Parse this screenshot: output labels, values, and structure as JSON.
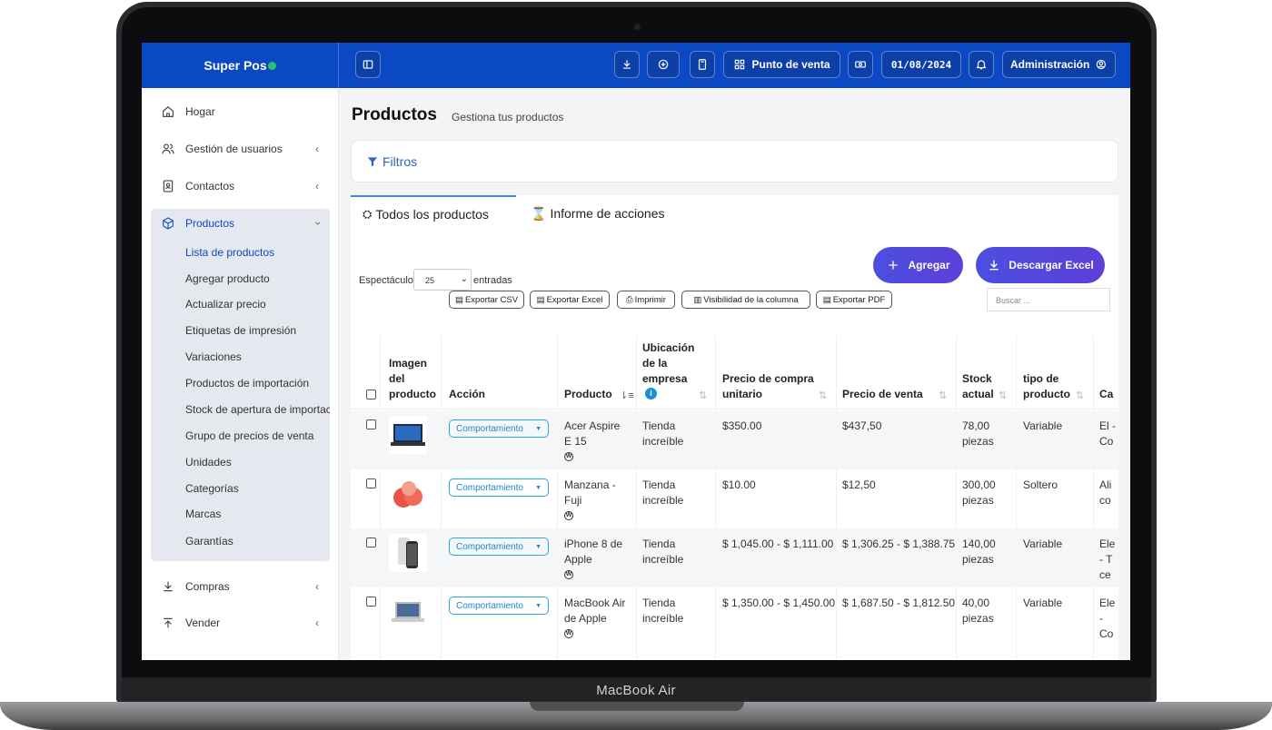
{
  "device": {
    "label": "MacBook Air"
  },
  "brand": {
    "name": "Super Pos"
  },
  "topbar": {
    "point_of_sale": "Punto de venta",
    "date": "01/08/2024",
    "admin": "Administración"
  },
  "sidebar": {
    "items": [
      {
        "label": "Hogar"
      },
      {
        "label": "Gestión de usuarios"
      },
      {
        "label": "Contactos"
      },
      {
        "label": "Productos"
      },
      {
        "label": "Compras"
      },
      {
        "label": "Vender"
      }
    ],
    "sub_items": [
      "Lista de productos",
      "Agregar producto",
      "Actualizar precio",
      "Etiquetas de impresión",
      "Variaciones",
      "Productos de importación",
      "Stock de apertura de importación",
      "Grupo de precios de venta",
      "Unidades",
      "Categorías",
      "Marcas",
      "Garantías"
    ]
  },
  "page": {
    "title": "Productos",
    "subtitle": "Gestiona tus productos",
    "filters": "Filtros"
  },
  "tabs": [
    "Todos los productos",
    "Informe de acciones"
  ],
  "actions": {
    "add": "Agregar",
    "download": "Descargar Excel"
  },
  "table_controls": {
    "show": "Espectáculo",
    "page_size": "25",
    "entries": "entradas",
    "search_placeholder": "Buscar ...",
    "export_buttons": [
      "Exportar CSV",
      "Exportar Excel",
      "Imprimir",
      "Visibilidad de la columna",
      "Exportar PDF"
    ]
  },
  "columns": [
    "Imagen del producto",
    "Acción",
    "Producto",
    "Ubicación de la empresa",
    "Precio de compra unitario",
    "Precio de venta",
    "Stock actual",
    "tipo de producto",
    "Ca"
  ],
  "action_label": "Comportamiento",
  "rows": [
    {
      "product": "Acer Aspire E 15",
      "location": "Tienda increíble",
      "purchase": "$350.00",
      "sale": "$437,50",
      "stock": "78,00 piezas",
      "type": "Variable",
      "cat": "El - Co"
    },
    {
      "product": "Manzana - Fuji",
      "location": "Tienda increíble",
      "purchase": "$10.00",
      "sale": "$12,50",
      "stock": "300,00 piezas",
      "type": "Soltero",
      "cat": "Ali co"
    },
    {
      "product": "iPhone 8 de Apple",
      "location": "Tienda increíble",
      "purchase": "$ 1,045.00 - $ 1,111.00",
      "sale": "$ 1,306.25 - $ 1,388.75",
      "stock": "140,00 piezas",
      "type": "Variable",
      "cat": "Ele - T ce"
    },
    {
      "product": "MacBook Air de Apple",
      "location": "Tienda increíble",
      "purchase": "$ 1,350.00 - $ 1,450.00",
      "sale": "$ 1,687.50 - $ 1,812.50",
      "stock": "40,00 piezas",
      "type": "Variable",
      "cat": "Ele - Co"
    }
  ]
}
